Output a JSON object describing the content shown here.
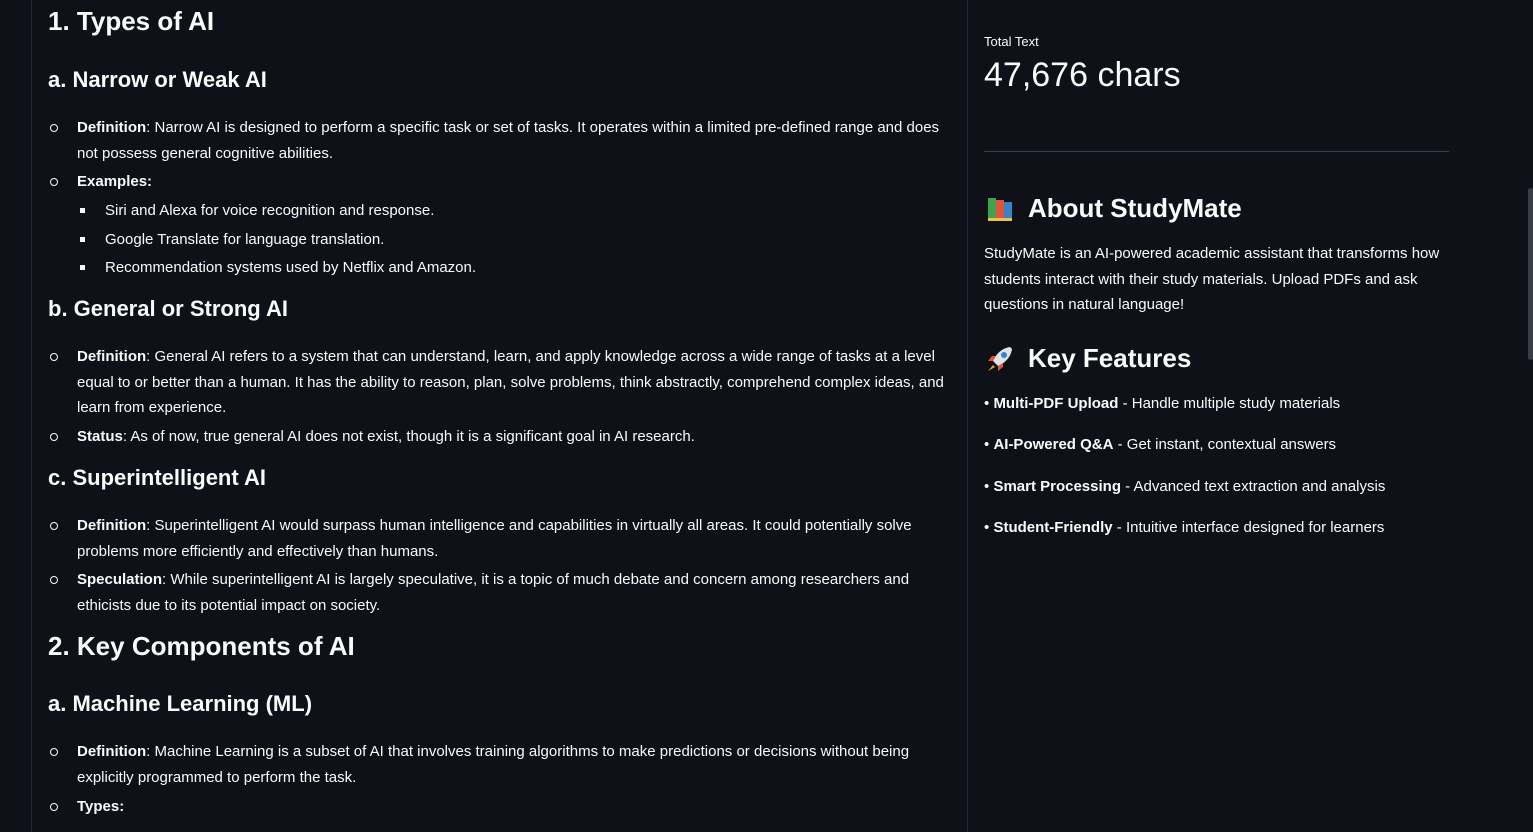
{
  "main": {
    "sec1_title": "1. Types of AI",
    "narrow": {
      "title": "a. Narrow or Weak AI",
      "def_label": "Definition",
      "def_text": ": Narrow AI is designed to perform a specific task or set of tasks. It operates within a limited pre-defined range and does not possess general cognitive abilities.",
      "examples_label": "Examples:",
      "examples": [
        "Siri and Alexa for voice recognition and response.",
        "Google Translate for language translation.",
        "Recommendation systems used by Netflix and Amazon."
      ]
    },
    "general": {
      "title": "b. General or Strong AI",
      "def_label": "Definition",
      "def_text": ": General AI refers to a system that can understand, learn, and apply knowledge across a wide range of tasks at a level equal to or better than a human. It has the ability to reason, plan, solve problems, think abstractly, comprehend complex ideas, and learn from experience.",
      "status_label": "Status",
      "status_text": ": As of now, true general AI does not exist, though it is a significant goal in AI research."
    },
    "super": {
      "title": "c. Superintelligent AI",
      "def_label": "Definition",
      "def_text": ": Superintelligent AI would surpass human intelligence and capabilities in virtually all areas. It could potentially solve problems more efficiently and effectively than humans.",
      "spec_label": "Speculation",
      "spec_text": ": While superintelligent AI is largely speculative, it is a topic of much debate and concern among researchers and ethicists due to its potential impact on society."
    },
    "sec2_title": "2. Key Components of AI",
    "ml": {
      "title": "a. Machine Learning (ML)",
      "def_label": "Definition",
      "def_text": ": Machine Learning is a subset of AI that involves training algorithms to make predictions or decisions without being explicitly programmed to perform the task.",
      "types_label": "Types:"
    }
  },
  "sidebar": {
    "metric_label": "Total Text",
    "metric_value": "47,676 chars",
    "about_title": "About StudyMate",
    "about_icon": "books-icon",
    "about_text": "StudyMate is an AI-powered academic assistant that transforms how students interact with their study materials. Upload PDFs and ask questions in natural language!",
    "features_title": "Key Features",
    "features_icon": "rocket-icon",
    "bullet_char": "•",
    "features": [
      {
        "name": "Multi-PDF Upload",
        "desc": " - Handle multiple study materials"
      },
      {
        "name": "AI-Powered Q&A",
        "desc": " - Get instant, contextual answers"
      },
      {
        "name": "Smart Processing",
        "desc": " - Advanced text extraction and analysis"
      },
      {
        "name": "Student-Friendly",
        "desc": " - Intuitive interface designed for learners"
      }
    ]
  }
}
